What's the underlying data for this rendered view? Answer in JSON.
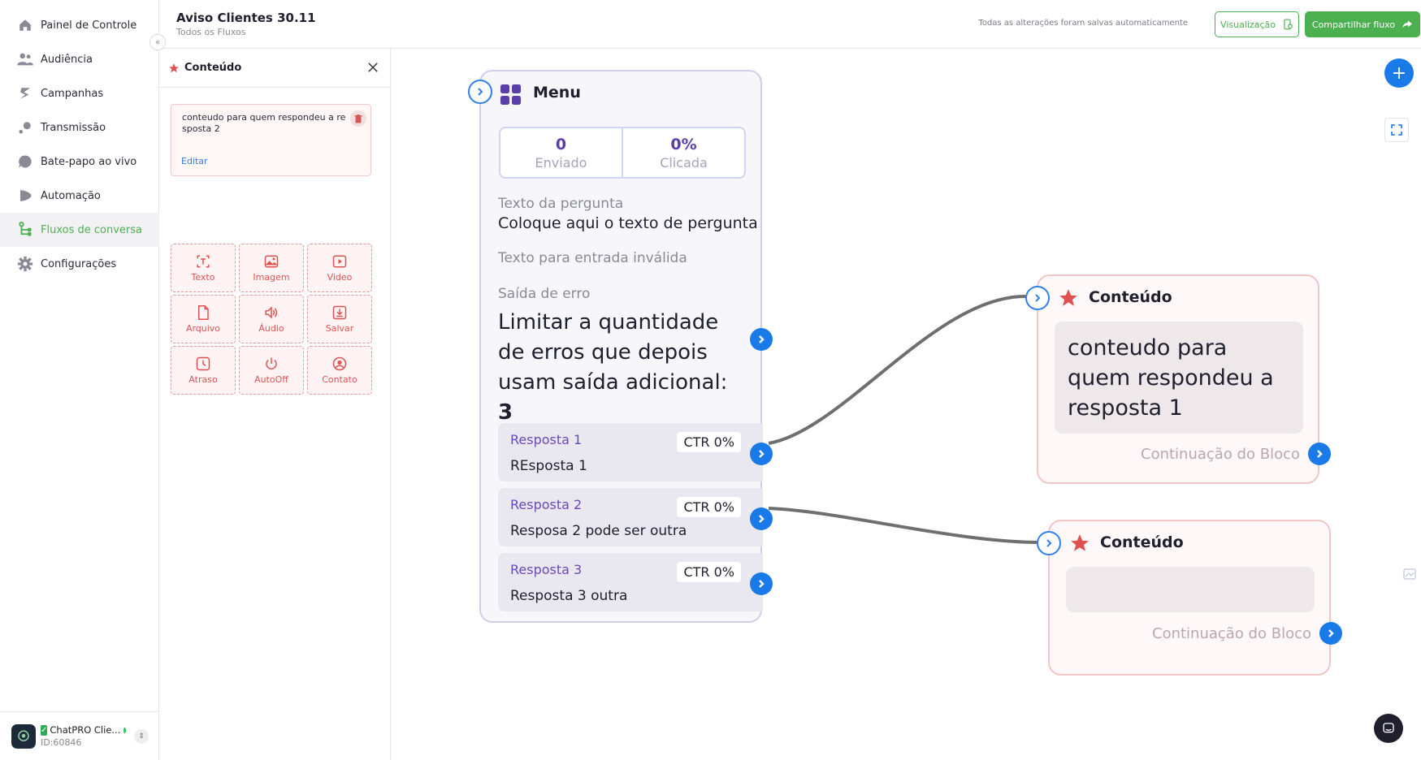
{
  "sidebar": {
    "items": [
      {
        "label": "Painel de Controle",
        "icon": "home-icon"
      },
      {
        "label": "Audiência",
        "icon": "users-icon"
      },
      {
        "label": "Campanhas",
        "icon": "campaign-icon"
      },
      {
        "label": "Transmissão",
        "icon": "broadcast-icon"
      },
      {
        "label": "Bate-papo ao vivo",
        "icon": "chat-bubble-icon"
      },
      {
        "label": "Automação",
        "icon": "automation-icon"
      },
      {
        "label": "Fluxos de conversa",
        "icon": "flow-icon",
        "active": true
      },
      {
        "label": "Configurações",
        "icon": "gear-icon"
      }
    ],
    "account": {
      "name": "ChatPRO Clie...",
      "id": "ID:60846"
    }
  },
  "header": {
    "title": "Aviso Clientes 30.11",
    "subtitle": "Todos os Fluxos",
    "saved_status": "Todas as alterações foram salvas automaticamente",
    "preview_label": "Visualização",
    "share_label": "Compartilhar fluxo"
  },
  "panel": {
    "title": "Conteúdo",
    "message_text": "conteudo para quem respondeu a resposta 2",
    "edit_label": "Editar",
    "tools": [
      {
        "label": "Texto",
        "icon": "text-icon"
      },
      {
        "label": "Imagem",
        "icon": "image-icon"
      },
      {
        "label": "Video",
        "icon": "video-icon"
      },
      {
        "label": "Arquivo",
        "icon": "file-icon"
      },
      {
        "label": "Áudio",
        "icon": "audio-icon"
      },
      {
        "label": "Salvar",
        "icon": "save-icon"
      },
      {
        "label": "Atraso",
        "icon": "clock-icon"
      },
      {
        "label": "AutoOff",
        "icon": "power-icon"
      },
      {
        "label": "Contato",
        "icon": "contact-icon"
      }
    ]
  },
  "menu_node": {
    "title": "Menu",
    "stats": [
      {
        "value": "0",
        "label": "Enviado"
      },
      {
        "value": "0%",
        "label": "Clicada"
      }
    ],
    "question_label": "Texto da pergunta",
    "question_value": "Coloque aqui o texto de pergunta",
    "invalid_label": "Texto para entrada inválida",
    "error_label": "Saída de erro",
    "error_text": "Limitar a quantidade de erros que depois usam saída adicional:",
    "error_count": "3",
    "responses": [
      {
        "title": "Resposta 1",
        "ctr": "CTR 0%",
        "value": "REsposta 1"
      },
      {
        "title": "Resposta 2",
        "ctr": "CTR 0%",
        "value": "Resposa 2 pode ser outra"
      },
      {
        "title": "Resposta 3",
        "ctr": "CTR 0%",
        "value": "Resposta 3 outra"
      }
    ]
  },
  "content_nodes": [
    {
      "title": "Conteúdo",
      "text": "conteudo para quem respondeu a resposta 1",
      "continuation": "Continuação do Bloco"
    },
    {
      "title": "Conteúdo",
      "text": "",
      "continuation": "Continuação do Bloco"
    }
  ],
  "colors": {
    "accent_green": "#4caf50",
    "port_blue": "#1a7ae8",
    "menu_purple": "#5b3fa8",
    "content_red": "#e05252"
  }
}
